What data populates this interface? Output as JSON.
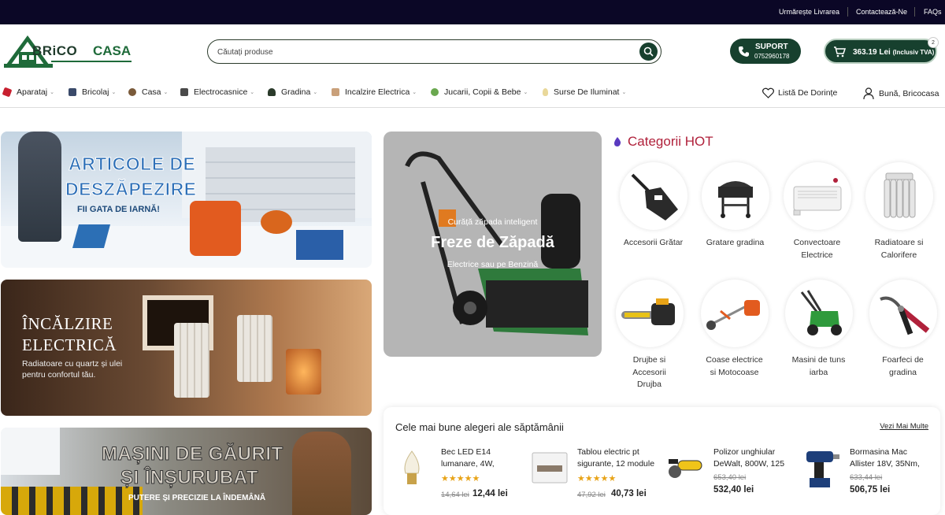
{
  "topbar": {
    "links": [
      "Urmărește Livrarea",
      "Contactează-Ne",
      "FAQs"
    ]
  },
  "logo": {
    "text_left": "BRiCO",
    "text_right": "CASA"
  },
  "search": {
    "placeholder": "Căutați produse"
  },
  "support": {
    "title": "SUPORT",
    "phone": "0752960178"
  },
  "cart": {
    "amount": "363.19 Lei",
    "tax_note": "(Inclusiv TVA)",
    "count": "2"
  },
  "nav": {
    "categories": [
      "Aparataj",
      "Bricolaj",
      "Casa",
      "Electrocasnice",
      "Gradina",
      "Incalzire Electrica",
      "Jucarii, Copii & Bebe",
      "Surse De Iluminat"
    ],
    "wishlist": "Listă De Dorințe",
    "account": "Bună, Bricocasa"
  },
  "banners": {
    "b1": {
      "line1": "ARTICOLE DE",
      "line2": "DESZĂPEZIRE",
      "sub": "FII GATA DE IARNĂ!"
    },
    "b2": {
      "line1": "ÎNCĂLZIRE",
      "line2": "ELECTRICĂ",
      "sub1": "Radiatoare cu quartz și ulei",
      "sub2": "pentru confortul tău."
    },
    "b3": {
      "line1": "MAȘINI DE GĂURIT",
      "line2": "ȘI ÎNȘURUBAT",
      "sub": "PUTERE ȘI PRECIZIE LA ÎNDEMÂNĂ"
    },
    "b4": {
      "top": "Curăță zăpada inteligent",
      "title": "Freze de Zăpadă",
      "sub": "Electrice sau pe Benzină"
    }
  },
  "hot": {
    "title": "Categorii HOT",
    "items": [
      {
        "label": [
          "Accesorii Grătar"
        ],
        "icon": "grill-accessory-icon"
      },
      {
        "label": [
          "Gratare gradina"
        ],
        "icon": "grill-icon"
      },
      {
        "label": [
          "Convectoare",
          "Electrice"
        ],
        "icon": "convector-icon"
      },
      {
        "label": [
          "Radiatoare si",
          "Calorifere"
        ],
        "icon": "radiator-icon"
      },
      {
        "label": [
          "Drujbe si",
          "Accesorii",
          "Drujba"
        ],
        "icon": "chainsaw-icon"
      },
      {
        "label": [
          "Coase electrice",
          "si Motocoase"
        ],
        "icon": "trimmer-icon"
      },
      {
        "label": [
          "Masini de tuns",
          "iarba"
        ],
        "icon": "lawnmower-icon"
      },
      {
        "label": [
          "Foarfeci de",
          "gradina"
        ],
        "icon": "pruning-shears-icon"
      }
    ]
  },
  "best": {
    "title": "Cele mai bune alegeri ale săptămânii",
    "more": "Vezi Mai Multe",
    "products": [
      {
        "name1": "Bec LED E14",
        "name2": "lumanare, 4W,",
        "stars": "★★★★★",
        "old": "14,64 lei",
        "new": "12,44 lei"
      },
      {
        "name1": "Tablou electric pt",
        "name2": "sigurante, 12 module",
        "stars": "★★★★★",
        "old": "47,92 lei",
        "new": "40,73 lei"
      },
      {
        "name1": "Polizor unghiular",
        "name2": "DeWalt, 800W, 125",
        "stars": "",
        "old": "653,40 lei",
        "new": "532,40 lei"
      },
      {
        "name1": "Bormasina Mac",
        "name2": "Allister 18V, 35Nm,",
        "stars": "",
        "old": "633,44 lei",
        "new": "506,75 lei"
      }
    ]
  },
  "colors": {
    "brand_green": "#17402e",
    "topbar": "#0b0726",
    "hot_red": "#b0213b",
    "star": "#e8a317"
  }
}
